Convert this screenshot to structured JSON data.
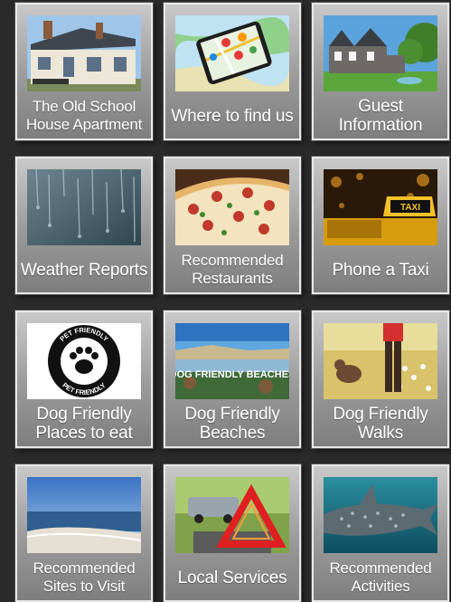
{
  "tiles": [
    {
      "label": "The Old School House Apartment",
      "icon": "house-photo"
    },
    {
      "label": "Where to find us",
      "icon": "map-phone-photo"
    },
    {
      "label": "Guest Information",
      "icon": "cottage-photo"
    },
    {
      "label": "Weather Reports",
      "icon": "rain-window-photo"
    },
    {
      "label": "Recommended Restaurants",
      "icon": "pizza-photo"
    },
    {
      "label": "Phone a Taxi",
      "icon": "taxi-sign-photo"
    },
    {
      "label": "Dog Friendly Places to eat",
      "icon": "pet-friendly-badge",
      "badge_text": "PET FRIENDLY"
    },
    {
      "label": "Dog Friendly Beaches",
      "icon": "beach-photo",
      "overlay_text": "DOG FRIENDLY BEACHES"
    },
    {
      "label": "Dog Friendly Walks",
      "icon": "dog-walk-photo"
    },
    {
      "label": "Recommended Sites to Visit",
      "icon": "coast-photo"
    },
    {
      "label": "Local Services",
      "icon": "warning-triangle-photo"
    },
    {
      "label": "Recommended Activities",
      "icon": "shark-photo"
    }
  ]
}
